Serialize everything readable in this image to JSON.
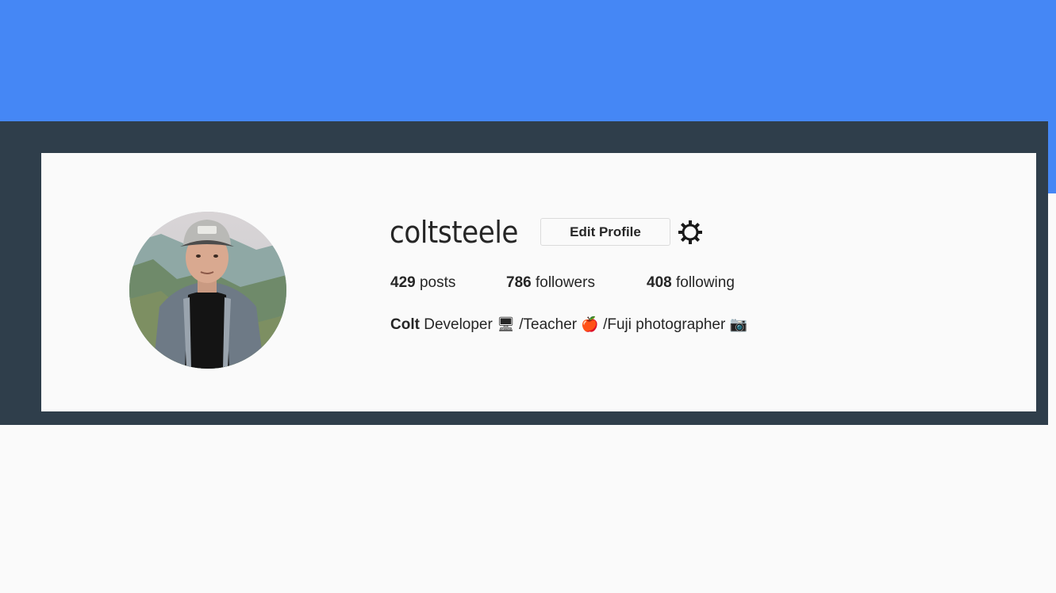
{
  "profile": {
    "username": "coltsteele",
    "edit_button": "Edit Profile",
    "settings_icon": "gear-icon",
    "avatar_icon": "profile-photo",
    "stats": {
      "posts_count": "429",
      "posts_label": "posts",
      "followers_count": "786",
      "followers_label": "followers",
      "following_count": "408",
      "following_label": "following"
    },
    "bio": {
      "name": "Colt",
      "part1": "Developer",
      "emoji1": "🖥",
      "part2": "/Teacher",
      "emoji2": "🍎",
      "part3": "/Fuji photographer",
      "emoji3": "📷"
    }
  },
  "colors": {
    "banner": "#4587f5",
    "frame": "#2f3e4b",
    "card": "#fafafa",
    "text": "#262626"
  }
}
